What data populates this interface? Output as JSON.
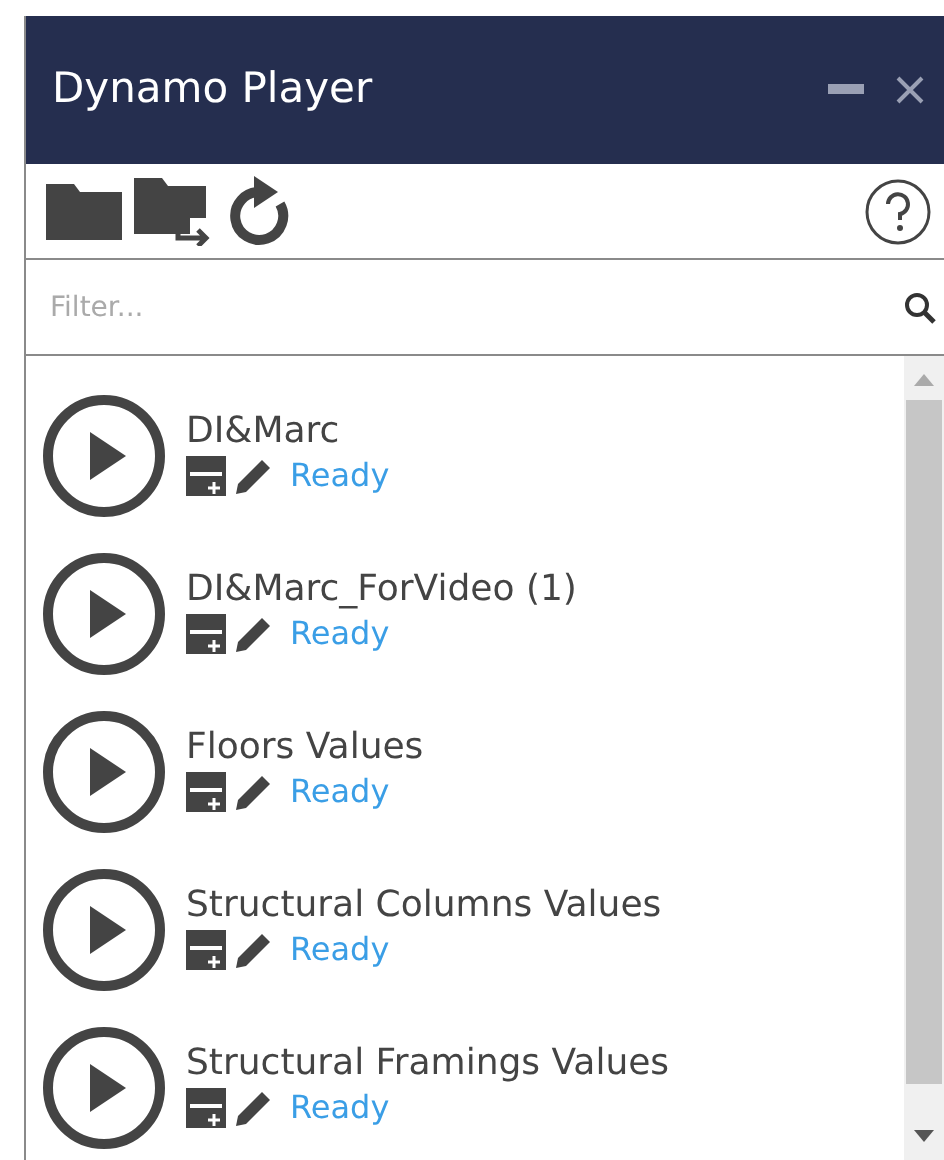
{
  "window": {
    "title": "Dynamo Player"
  },
  "filter": {
    "placeholder": "Filter..."
  },
  "scripts": [
    {
      "name": "DI&Marc",
      "status": "Ready"
    },
    {
      "name": "DI&Marc_ForVideo (1)",
      "status": "Ready"
    },
    {
      "name": "Floors Values",
      "status": "Ready"
    },
    {
      "name": "Structural Columns Values",
      "status": "Ready"
    },
    {
      "name": "Structural Framings Values",
      "status": "Ready"
    }
  ]
}
